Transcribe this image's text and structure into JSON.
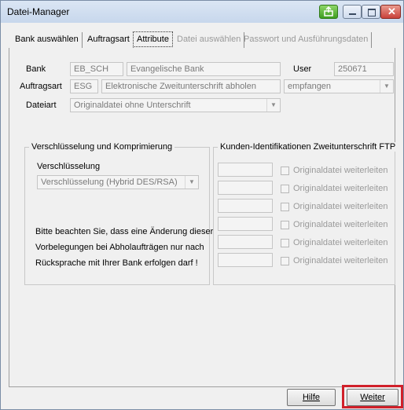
{
  "window": {
    "title": "Datei-Manager"
  },
  "tabs": [
    {
      "label": "Bank auswählen",
      "state": "normal"
    },
    {
      "label": "Auftragsart",
      "state": "normal"
    },
    {
      "label": "Attribute",
      "state": "active"
    },
    {
      "label": "Datei auswählen",
      "state": "disabled"
    },
    {
      "label": "Passwort und Ausführungsdaten",
      "state": "disabled"
    }
  ],
  "form": {
    "bank_label": "Bank",
    "bank_code": "EB_SCH",
    "bank_name": "Evangelische Bank",
    "user_label": "User",
    "user_value": "250671",
    "auftragsart_label": "Auftragsart",
    "auftragsart_code": "ESG",
    "auftragsart_desc": "Elektronische Zweitunterschrift abholen",
    "direction_value": "empfangen",
    "dateiart_label": "Dateiart",
    "dateiart_value": "Originaldatei ohne Unterschrift"
  },
  "encryption_group": {
    "title": "Verschlüsselung und Komprimierung",
    "encryption_label": "Verschlüsselung",
    "encryption_value": "Verschlüsselung (Hybrid DES/RSA)",
    "note_lines": [
      "Bitte beachten Sie, dass eine Änderung dieser",
      "Vorbelegungen bei Abholaufträgen nur nach",
      "Rücksprache mit Ihrer Bank erfolgen darf !"
    ]
  },
  "ftp_group": {
    "title": "Kunden-Identifikationen Zweitunterschrift FTP",
    "rows": [
      {
        "id_value": "",
        "checkbox_label": "Originaldatei weiterleiten",
        "checked": false
      },
      {
        "id_value": "",
        "checkbox_label": "Originaldatei weiterleiten",
        "checked": false
      },
      {
        "id_value": "",
        "checkbox_label": "Originaldatei weiterleiten",
        "checked": false
      },
      {
        "id_value": "",
        "checkbox_label": "Originaldatei weiterleiten",
        "checked": false
      },
      {
        "id_value": "",
        "checkbox_label": "Originaldatei weiterleiten",
        "checked": false
      },
      {
        "id_value": "",
        "checkbox_label": "Originaldatei weiterleiten",
        "checked": false
      }
    ]
  },
  "buttons": {
    "help": "Hilfe",
    "next": "Weiter"
  },
  "colors": {
    "highlight": "#d0202a",
    "close_button": "#c9413a",
    "export_button": "#4caf2a"
  }
}
